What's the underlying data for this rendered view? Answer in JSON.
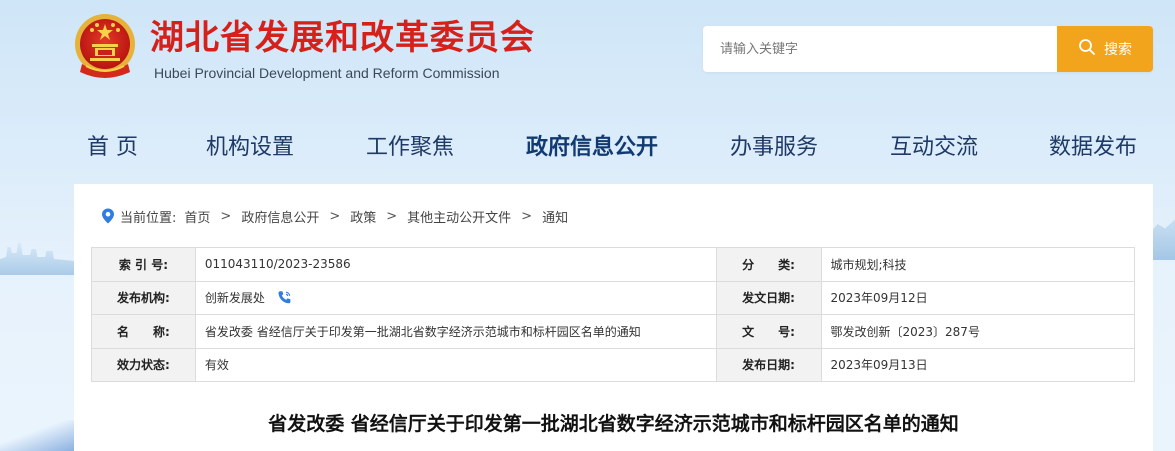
{
  "header": {
    "title": "湖北省发展和改革委员会",
    "subtitle": "Hubei Provincial Development and Reform Commission",
    "emblem_icon": "national-emblem-icon"
  },
  "search": {
    "placeholder": "请输入关键字",
    "button_label": "搜索",
    "button_color": "#f2a51c"
  },
  "nav": {
    "items": [
      {
        "label": "首 页"
      },
      {
        "label": "机构设置"
      },
      {
        "label": "工作聚焦"
      },
      {
        "label": "政府信息公开",
        "active": true
      },
      {
        "label": "办事服务"
      },
      {
        "label": "互动交流"
      },
      {
        "label": "数据发布"
      }
    ]
  },
  "breadcrumb": {
    "prefix": "当前位置:",
    "items": [
      "首页",
      "政府信息公开",
      "政策",
      "其他主动公开文件",
      "通知"
    ],
    "separator": ">"
  },
  "meta": {
    "rows": [
      [
        {
          "label": "索 引 号:",
          "value": "011043110/2023-23586"
        },
        {
          "label": "分　　类:",
          "value": "城市规划;科技"
        }
      ],
      [
        {
          "label": "发布机构:",
          "value": "创新发展处"
        },
        {
          "label": "发文日期:",
          "value": "2023年09月12日"
        }
      ],
      [
        {
          "label": "名　　称:",
          "value": "省发改委 省经信厅关于印发第一批湖北省数字经济示范城市和标杆园区名单的通知"
        },
        {
          "label": "文　　号:",
          "value": "鄂发改创新〔2023〕287号"
        }
      ],
      [
        {
          "label": "效力状态:",
          "value": "有效"
        },
        {
          "label": "发布日期:",
          "value": "2023年09月13日"
        }
      ]
    ]
  },
  "document": {
    "title": "省发改委 省经信厅关于印发第一批湖北省数字经济示范城市和标杆园区名单的通知"
  },
  "colors": {
    "title_red": "#d6201a",
    "nav_blue": "#1f3a66",
    "pin_blue": "#2f7de1"
  }
}
